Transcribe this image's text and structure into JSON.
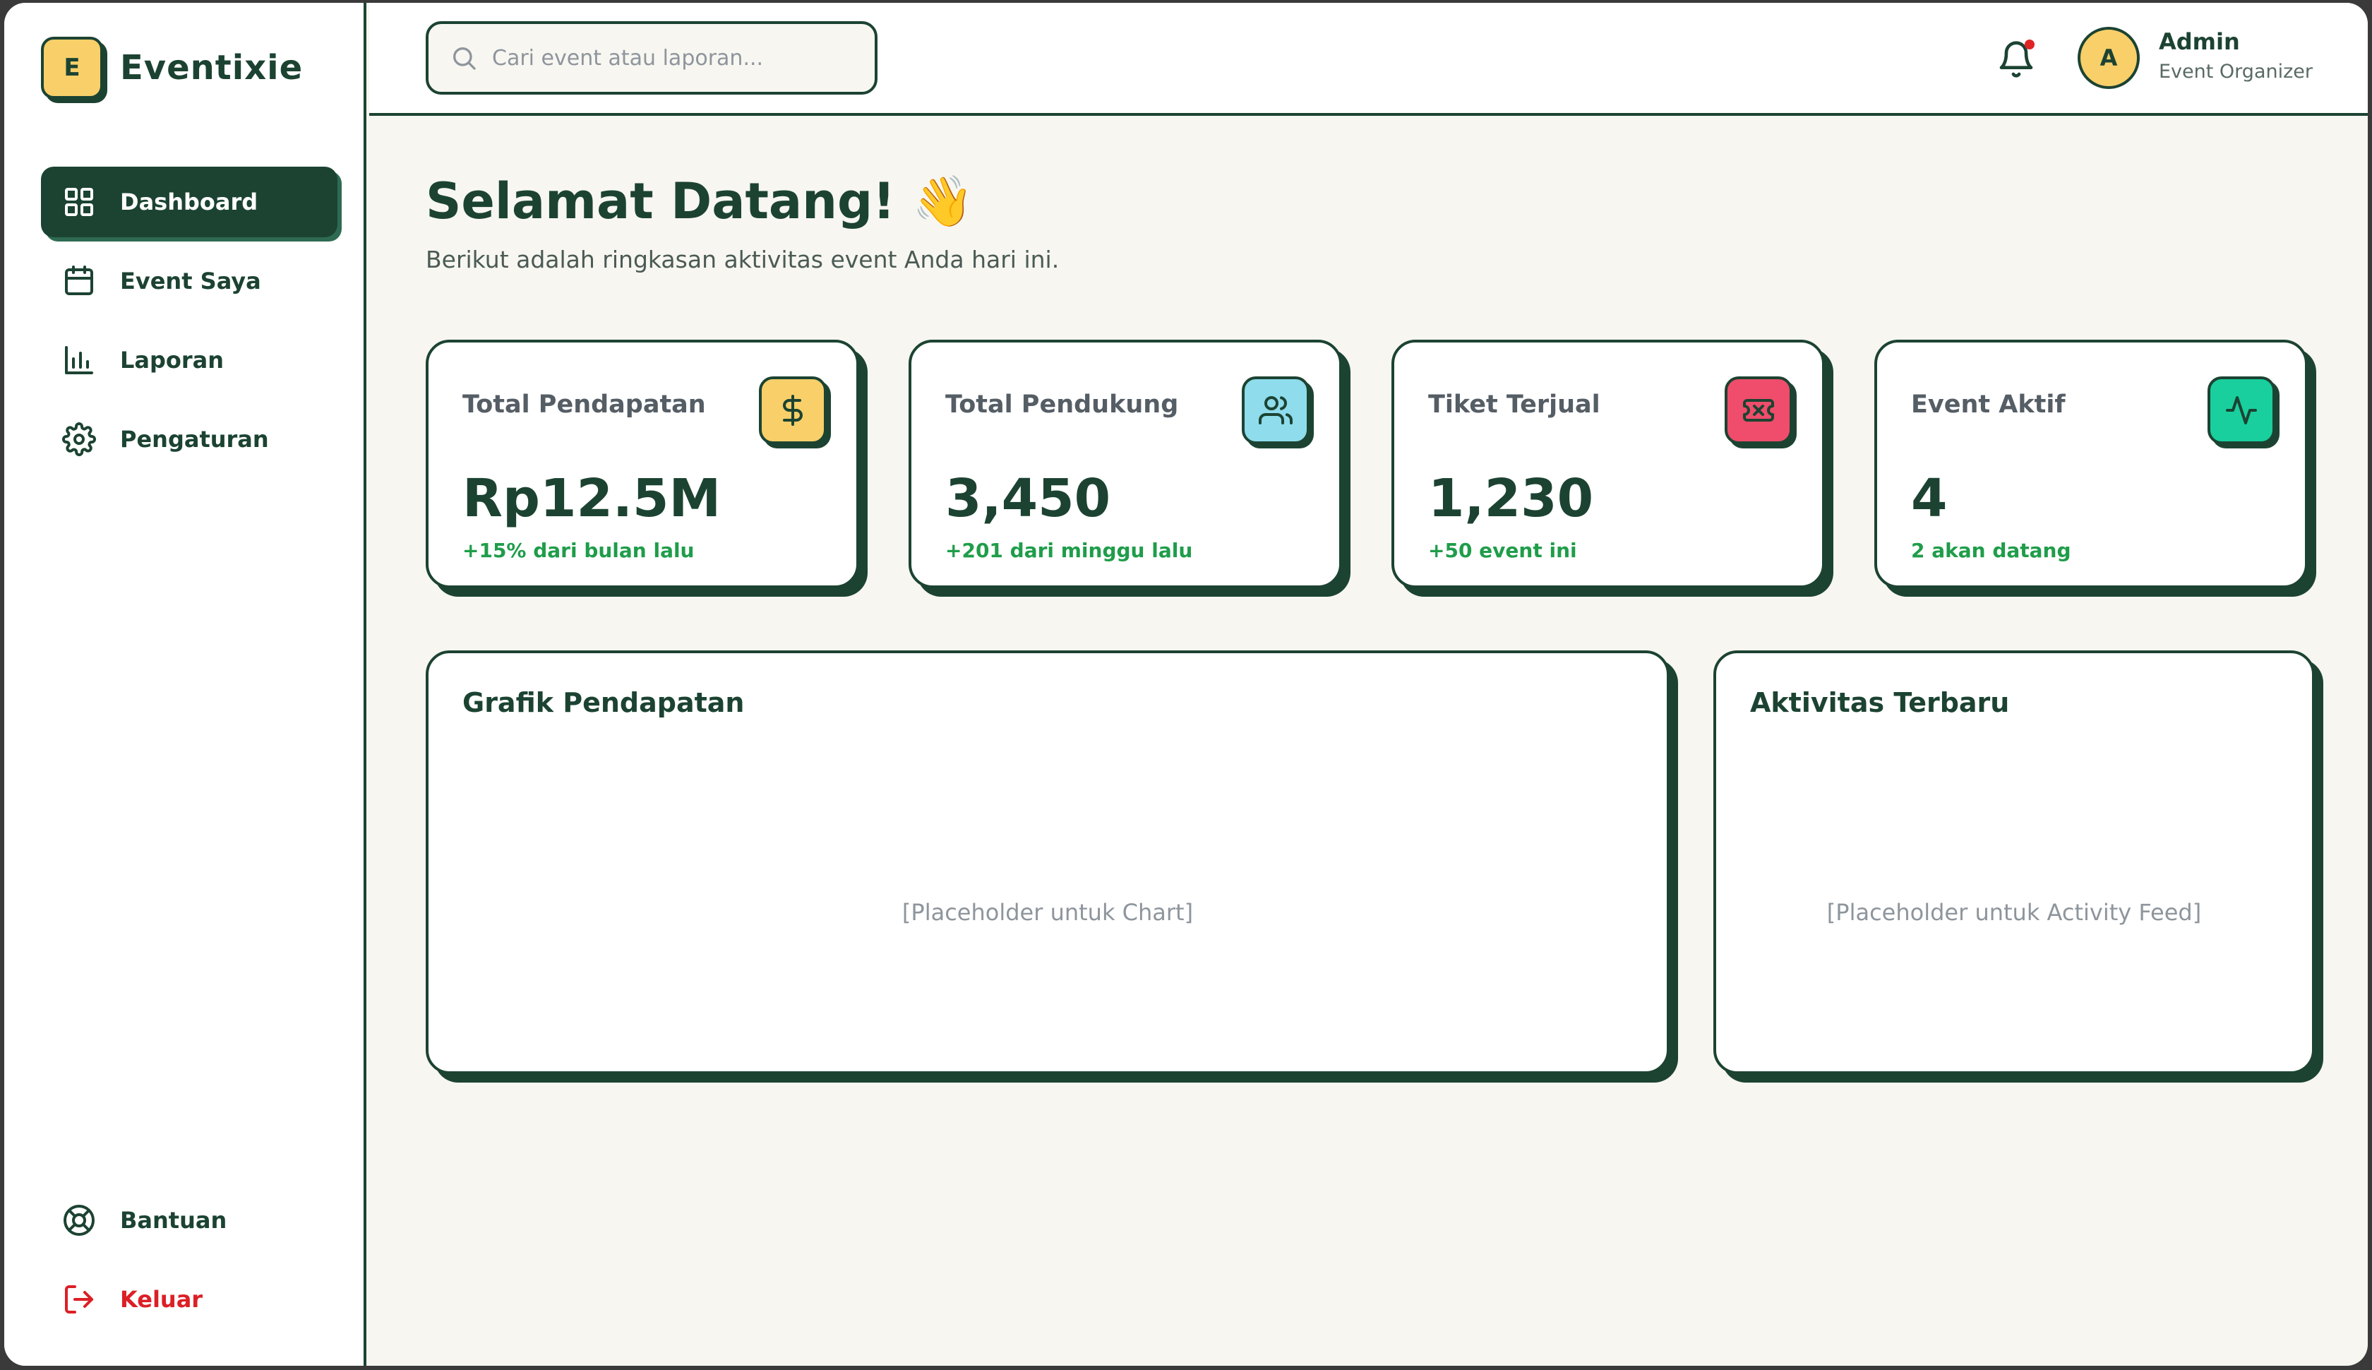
{
  "app": {
    "logo_letter": "E",
    "name": "Eventixie"
  },
  "sidebar": {
    "items": [
      {
        "label": "Dashboard",
        "icon": "grid-icon"
      },
      {
        "label": "Event Saya",
        "icon": "calendar-icon"
      },
      {
        "label": "Laporan",
        "icon": "bar-chart-icon"
      },
      {
        "label": "Pengaturan",
        "icon": "gear-icon"
      }
    ],
    "bottom": [
      {
        "label": "Bantuan",
        "icon": "lifebuoy-icon"
      },
      {
        "label": "Keluar",
        "icon": "logout-icon"
      }
    ]
  },
  "search": {
    "placeholder": "Cari event atau laporan..."
  },
  "user": {
    "initial": "A",
    "name": "Admin",
    "role": "Event Organizer"
  },
  "main": {
    "welcome": "Selamat Datang! 👋",
    "subtitle": "Berikut adalah ringkasan aktivitas event Anda hari ini."
  },
  "stats": [
    {
      "label": "Total Pendapatan",
      "value": "Rp12.5M",
      "delta": "+15% dari bulan lalu",
      "icon": "dollar-icon",
      "color": "#f8cf69"
    },
    {
      "label": "Total Pendukung",
      "value": "3,450",
      "delta": "+201 dari minggu lalu",
      "icon": "users-icon",
      "color": "#8edcec"
    },
    {
      "label": "Tiket Terjual",
      "value": "1,230",
      "delta": "+50 event ini",
      "icon": "ticket-icon",
      "color": "#ef4d6b"
    },
    {
      "label": "Event Aktif",
      "value": "4",
      "delta": "2 akan datang",
      "icon": "activity-icon",
      "color": "#18cf9d"
    }
  ],
  "panels": {
    "chart": {
      "title": "Grafik Pendapatan",
      "placeholder": "[Placeholder untuk Chart]"
    },
    "activity": {
      "title": "Aktivitas Terbaru",
      "placeholder": "[Placeholder untuk Activity Feed]"
    }
  },
  "colors": {
    "primary": "#1c4332",
    "accent": "#f8cf69",
    "danger": "#dc1f26",
    "positive": "#1f9d4a",
    "background": "#f7f6f1"
  }
}
